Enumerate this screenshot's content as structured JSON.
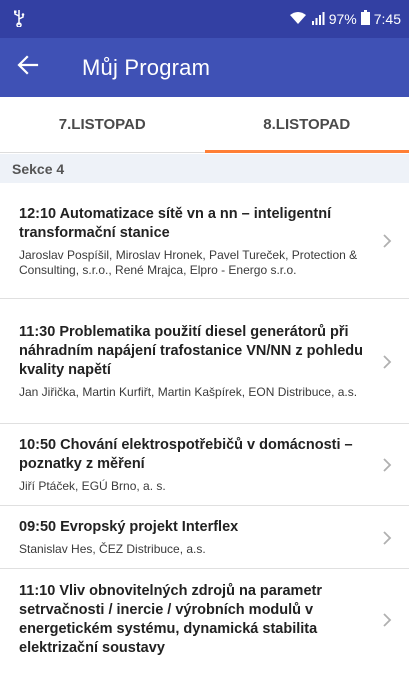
{
  "status_bar": {
    "battery_percent": "97%",
    "time": "7:45",
    "icons": [
      "usb-icon",
      "wifi-icon",
      "signal-icon",
      "battery-icon"
    ]
  },
  "app_bar": {
    "title": "Můj Program",
    "back_icon": "arrow-left-icon"
  },
  "tabs": [
    {
      "label": "7.LISTOPAD",
      "active": false
    },
    {
      "label": "8.LISTOPAD",
      "active": true
    }
  ],
  "section": {
    "title": "Sekce 4"
  },
  "items": [
    {
      "title": "12:10 Automatizace sítě vn a nn – inteligentní transformační stanice",
      "authors": "Jaroslav Pospíšil, Miroslav Hronek, Pavel Tureček, Protection & Consulting, s.r.o., René Mrajca, Elpro - Energo s.r.o."
    },
    {
      "title": "11:30 Problematika použití diesel generátorů při náhradním napájení trafostanice VN/NN z pohledu kvality napětí",
      "authors": "Jan Jiřička, Martin Kurfiřt, Martin Kašpírek, EON Distribuce, a.s."
    },
    {
      "title": "10:50 Chování elektrospotřebičů v domácnosti – poznatky z měření",
      "authors": "Jiří Ptáček, EGÚ Brno, a. s."
    },
    {
      "title": "09:50 Evropský projekt Interflex",
      "authors": "Stanislav Hes, ČEZ Distribuce, a.s."
    },
    {
      "title": "11:10 Vliv obnovitelných zdrojů na parametr setrvačnosti / inercie / výrobních modulů v energetickém systému, dynamická stabilita elektrizační soustavy",
      "authors": ""
    }
  ],
  "colors": {
    "status_bar": "#3340a3",
    "app_bar": "#3f51b5",
    "tab_indicator": "#ff7f36",
    "section_bg": "#eef2f8"
  }
}
